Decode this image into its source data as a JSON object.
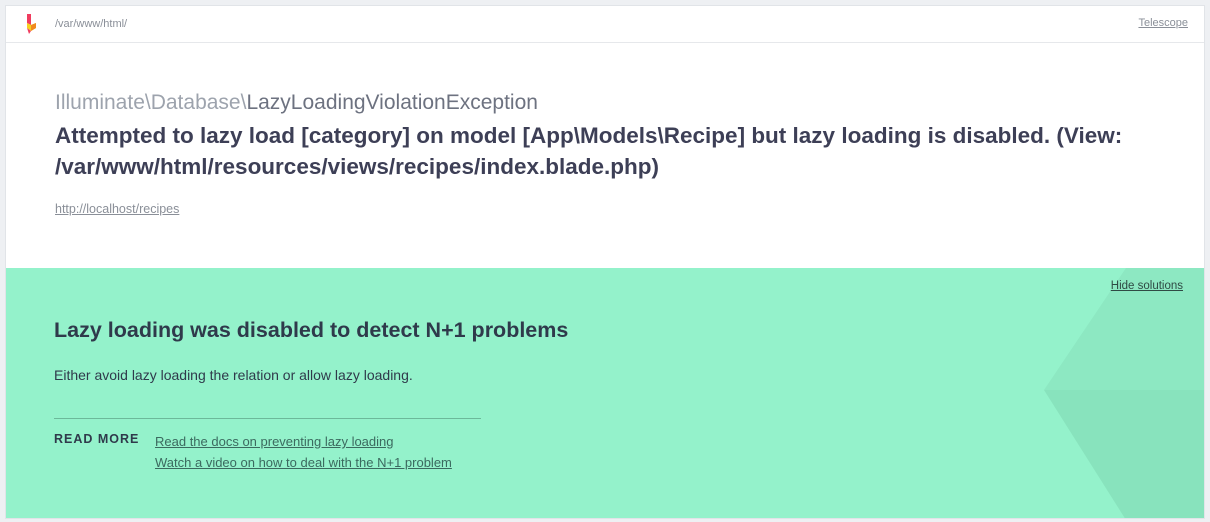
{
  "header": {
    "path": "/var/www/html/",
    "telescope_label": "Telescope"
  },
  "exception": {
    "class_prefix": "Illuminate\\Database\\",
    "class_name": "LazyLoadingViolationException",
    "message": "Attempted to lazy load [category] on model [App\\Models\\Recipe] but lazy loading is disabled. (View: /var/www/html/resources/views/recipes/index.blade.php)",
    "url": "http://localhost/recipes"
  },
  "solution": {
    "hide_label": "Hide solutions",
    "title": "Lazy loading was disabled to detect N+1 problems",
    "description": "Either avoid lazy loading the relation or allow lazy loading.",
    "read_more_label": "READ MORE",
    "links": [
      "Read the docs on preventing lazy loading",
      "Watch a video on how to deal with the N+1 problem"
    ]
  },
  "colors": {
    "solution_bg": "#94f2cb",
    "logo_red": "#f03c5f",
    "logo_yellow": "#f7d11e"
  },
  "icons": {
    "logo": "ignition-logo"
  }
}
